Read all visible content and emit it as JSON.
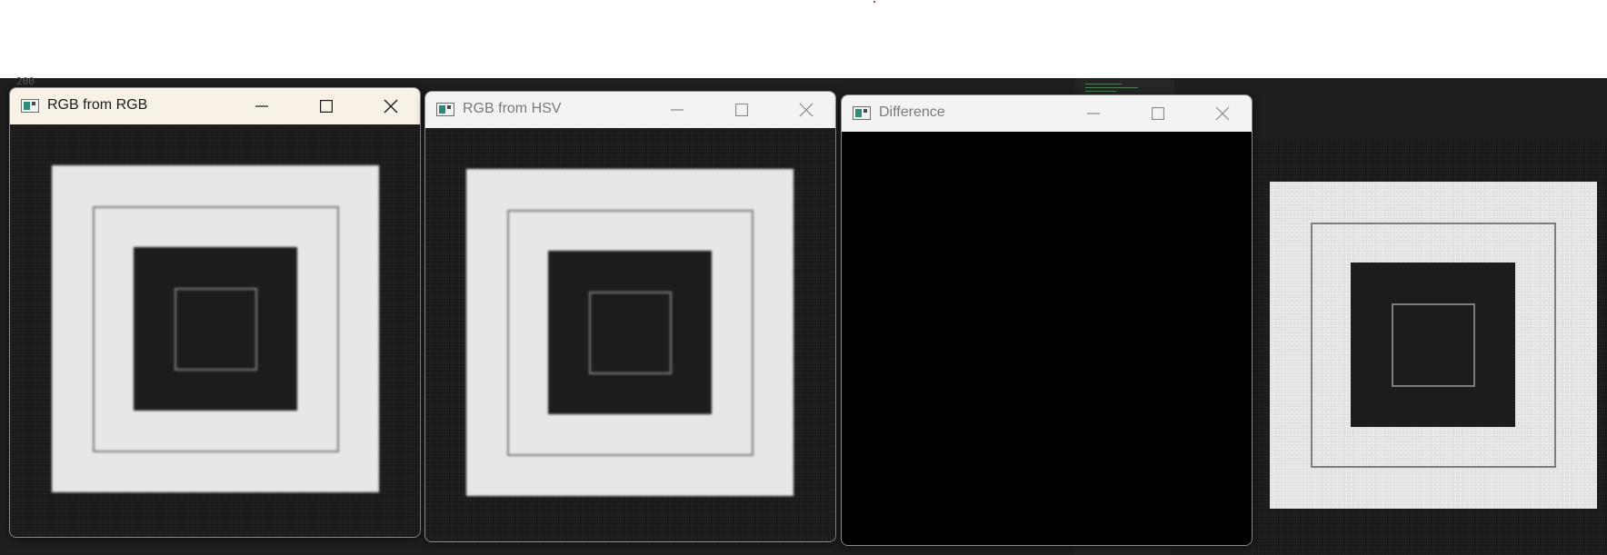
{
  "windows": {
    "rgb_from_rgb": {
      "title": "RGB from RGB"
    },
    "rgb_from_hsv": {
      "title": "RGB from HSV"
    },
    "difference": {
      "title": "Difference"
    }
  },
  "background": {
    "faint_text": "200"
  },
  "colors": {
    "titlebar_active": "#f8f1e6",
    "titlebar_inactive": "#f3f3f3",
    "desktop": "#1f1f1f",
    "image_light": "#e7e7e7",
    "image_dark": "#1a1a1a",
    "outline": "#7d7d7d",
    "difference_fill": "#000000"
  },
  "icons": [
    "app-window-icon",
    "minimize-icon",
    "maximize-icon",
    "close-icon"
  ]
}
